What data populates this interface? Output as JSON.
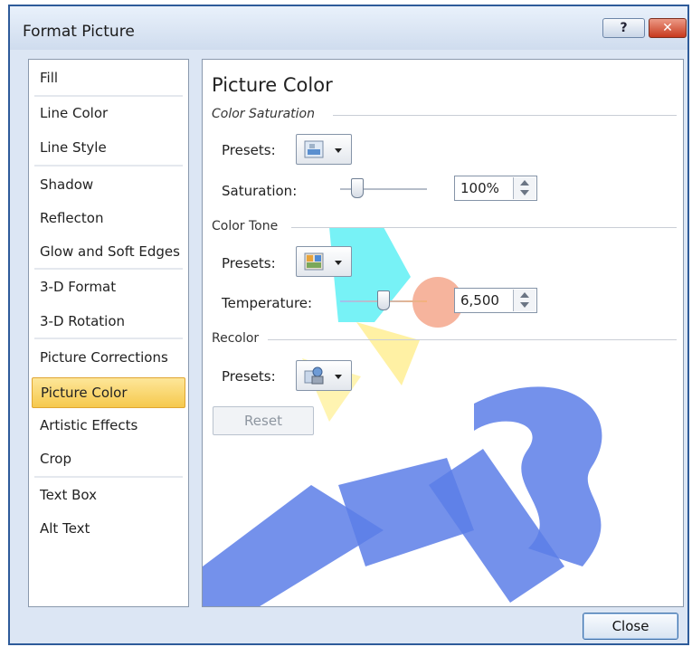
{
  "window": {
    "title": "Format Picture",
    "help_label": "?",
    "close_glyph": "✕"
  },
  "nav": {
    "items": [
      {
        "label": "Fill"
      },
      {
        "label": "Line Color"
      },
      {
        "label": "Line Style"
      },
      {
        "label": "Shadow"
      },
      {
        "label": "Reflecton"
      },
      {
        "label": "Glow and Soft Edges"
      },
      {
        "label": "3-D Format"
      },
      {
        "label": "3-D Rotation"
      },
      {
        "label": "Picture Corrections"
      },
      {
        "label": "Picture Color",
        "selected": true
      },
      {
        "label": "Artistic Effects"
      },
      {
        "label": "Crop"
      },
      {
        "label": "Text Box"
      },
      {
        "label": "Alt Text"
      }
    ]
  },
  "panel": {
    "heading": "Picture Color",
    "color_saturation": {
      "section": "Color Saturation",
      "presets_label": "Presets:",
      "saturation_label": "Saturation:",
      "saturation_value": "100%",
      "saturation_slider_fraction": 0.2
    },
    "color_tone": {
      "section": "Color Tone",
      "presets_label": "Presets:",
      "temperature_label": "Temperature:",
      "temperature_value": "6,500",
      "temperature_slider_fraction": 0.5
    },
    "recolor": {
      "section": "Recolor",
      "presets_label": "Presets:"
    },
    "reset_label": "Reset"
  },
  "footer": {
    "close_label": "Close"
  },
  "icons": [
    "help-icon",
    "close-icon",
    "saturation-preset-icon",
    "tone-preset-icon",
    "recolor-preset-icon",
    "dropdown-arrow-icon",
    "spin-up-icon",
    "spin-down-icon"
  ],
  "colors": {
    "accent_selected": "#f6c94d",
    "titlebar": "#dce6f4",
    "close_red": "#c7391d"
  }
}
